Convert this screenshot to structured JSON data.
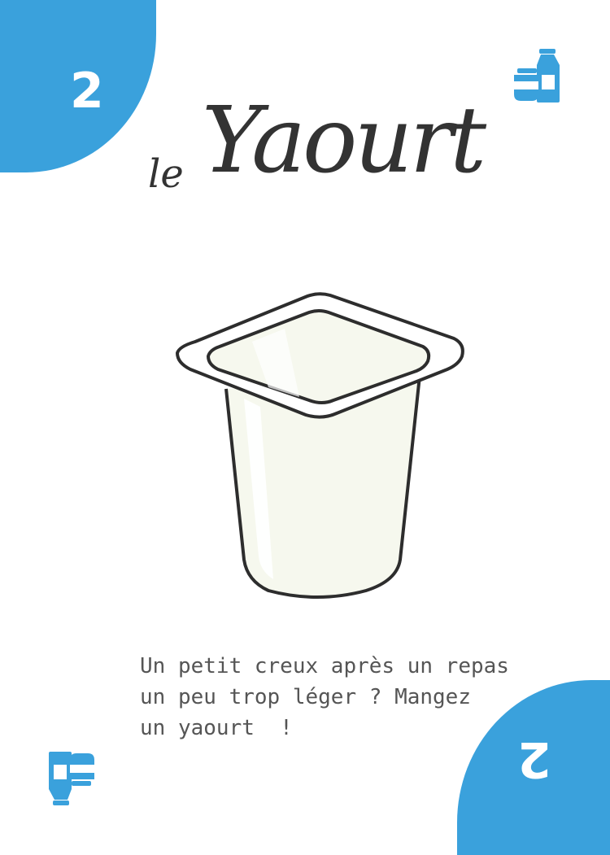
{
  "card": {
    "number_top": "2",
    "number_bottom": "2",
    "title_article": "le",
    "title_word": "Yaourt",
    "description_lines": [
      "Un petit creux après un repas",
      "un peu trop léger ? Mangez",
      "un yaourt  !"
    ],
    "icons": {
      "top_right": "dairy-icon",
      "bottom_left": "dairy-icon"
    },
    "illustration": "yogurt-cup"
  },
  "colors": {
    "accent": "#3aa1dc",
    "ink": "#333333",
    "text": "#555555",
    "cup_fill": "#f6f8ee",
    "background": "#ffffff"
  }
}
